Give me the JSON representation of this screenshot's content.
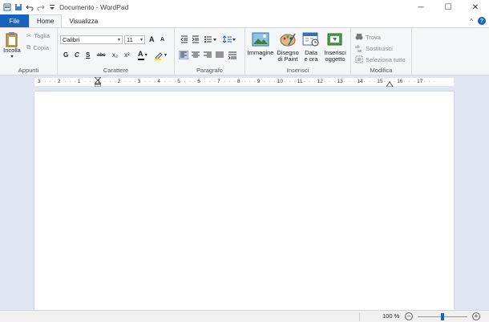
{
  "title": "Documento - WordPad",
  "window_controls": {
    "minimize": "─",
    "maximize": "☐",
    "close": "✕"
  },
  "tabs": {
    "file": "File",
    "home": "Home",
    "view": "Visualizza"
  },
  "tabs_right": {
    "collapse": "^",
    "help": "?"
  },
  "clipboard": {
    "paste": "Incolla",
    "cut": "Taglia",
    "copy": "Copia",
    "group": "Appunti"
  },
  "font": {
    "family": "Calibri",
    "size": "11",
    "grow": "A",
    "shrink": "A",
    "bold": "G",
    "italic": "C",
    "underline": "S",
    "strike": "abc",
    "subscript": "x₂",
    "superscript": "x²",
    "color_letter": "A",
    "group": "Carattere"
  },
  "paragraph": {
    "group": "Paragrafo"
  },
  "insert": {
    "image": "Immagine",
    "paint_line1": "Disegno",
    "paint_line2": "di Paint",
    "date_line1": "Data",
    "date_line2": "e ora",
    "object_line1": "Inserisci",
    "object_line2": "oggetto",
    "group": "Inserisci"
  },
  "edit": {
    "find": "Trova",
    "replace": "Sostituisci",
    "select_all": "Seleziona tutto",
    "group": "Modifica"
  },
  "ruler": [
    "3",
    "2",
    "1",
    "1",
    "2",
    "3",
    "4",
    "5",
    "6",
    "7",
    "8",
    "9",
    "10",
    "11",
    "12",
    "13",
    "14",
    "15",
    "16",
    "17"
  ],
  "status": {
    "zoom": "100 %",
    "zoom_out": "−",
    "zoom_in": "+",
    "zoom_level": 1.0
  },
  "colors": {
    "accent": "#1a62b8",
    "ribbon": "#f5f6f7",
    "doc_bg": "#dfe6f2"
  }
}
